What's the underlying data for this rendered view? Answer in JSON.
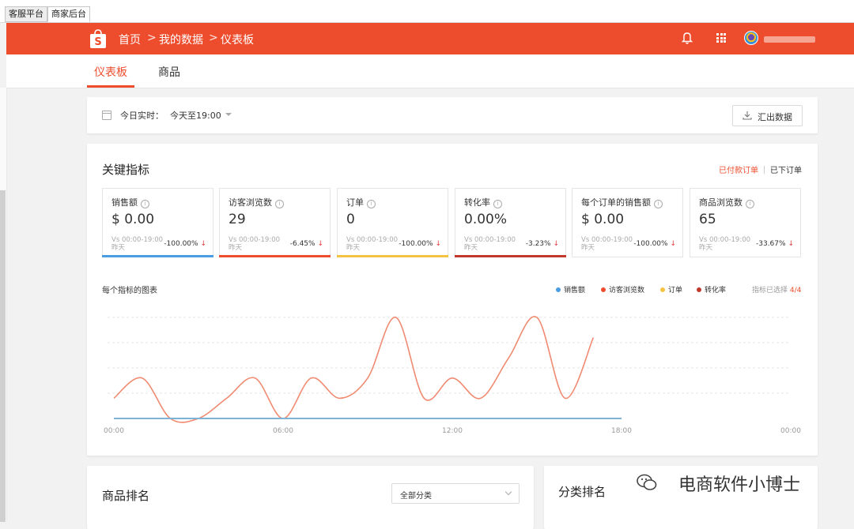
{
  "top_tabs": [
    "客服平台",
    "商家后台"
  ],
  "header": {
    "breadcrumb": [
      "首页",
      "我的数据",
      "仪表板"
    ],
    "separator": ">",
    "brand_color": "#ee4d2d"
  },
  "subnav": {
    "tabs": [
      "仪表板",
      "商品"
    ]
  },
  "filter": {
    "label": "今日实时：",
    "value": "今天至19:00",
    "export_label": "汇出数据"
  },
  "key_metrics": {
    "title": "关键指标",
    "toggle": {
      "paid": "已付款订单",
      "placed": "已下订单"
    },
    "cards": [
      {
        "name": "销售额",
        "value": "$ 0.00",
        "vs": "Vs 00:00-19:00 昨天",
        "change": "-100.00%",
        "color": "#4a9de2"
      },
      {
        "name": "访客浏览数",
        "value": "29",
        "vs": "Vs 00:00-19:00 昨天",
        "change": "-6.45%",
        "color": "#ee4d2d"
      },
      {
        "name": "订单",
        "value": "0",
        "vs": "Vs 00:00-19:00 昨天",
        "change": "-100.00%",
        "color": "#f5c342"
      },
      {
        "name": "转化率",
        "value": "0.00%",
        "vs": "Vs 00:00-19:00 昨天",
        "change": "-3.23%",
        "color": "#c0392b"
      },
      {
        "name": "每个订单的销售额",
        "value": "$ 0.00",
        "vs": "Vs 00:00-19:00 昨天",
        "change": "-100.00%",
        "color": "#ffffff"
      },
      {
        "name": "商品浏览数",
        "value": "65",
        "vs": "Vs 00:00-19:00 昨天",
        "change": "-33.67%",
        "color": "#ffffff"
      }
    ]
  },
  "chart": {
    "title": "每个指标的图表",
    "selected_label": "指标已选择",
    "selected_count": "4/4",
    "legend": [
      {
        "name": "销售额",
        "color": "#4a9de2"
      },
      {
        "name": "访客浏览数",
        "color": "#ee4d2d"
      },
      {
        "name": "订单",
        "color": "#f5c342"
      },
      {
        "name": "转化率",
        "color": "#c0392b"
      }
    ]
  },
  "chart_data": {
    "type": "line",
    "title": "每个指标的图表",
    "x": [
      "00:00",
      "01:00",
      "02:00",
      "03:00",
      "04:00",
      "05:00",
      "06:00",
      "07:00",
      "08:00",
      "09:00",
      "10:00",
      "11:00",
      "12:00",
      "13:00",
      "14:00",
      "15:00",
      "16:00",
      "17:00",
      "18:00"
    ],
    "xticks": [
      "00:00",
      "06:00",
      "12:00",
      "18:00",
      "00:00"
    ],
    "ylim": [
      0,
      5
    ],
    "grid": true,
    "series": [
      {
        "name": "访客浏览数",
        "color": "#f08a70",
        "values": [
          1,
          2,
          0,
          0,
          1,
          2,
          0,
          2,
          1,
          2,
          5,
          1,
          2,
          1,
          3,
          5,
          1,
          4,
          null
        ]
      },
      {
        "name": "销售额",
        "color": "#7fb3d5",
        "values": [
          0,
          0,
          0,
          0,
          0,
          0,
          0,
          0,
          0,
          0,
          0,
          0,
          0,
          0,
          0,
          0,
          0,
          0,
          0
        ]
      }
    ]
  },
  "product_rank": {
    "title": "商品排名",
    "select": "全部分类"
  },
  "category_rank": {
    "title": "分类排名"
  },
  "watermark": "电商软件小博士"
}
